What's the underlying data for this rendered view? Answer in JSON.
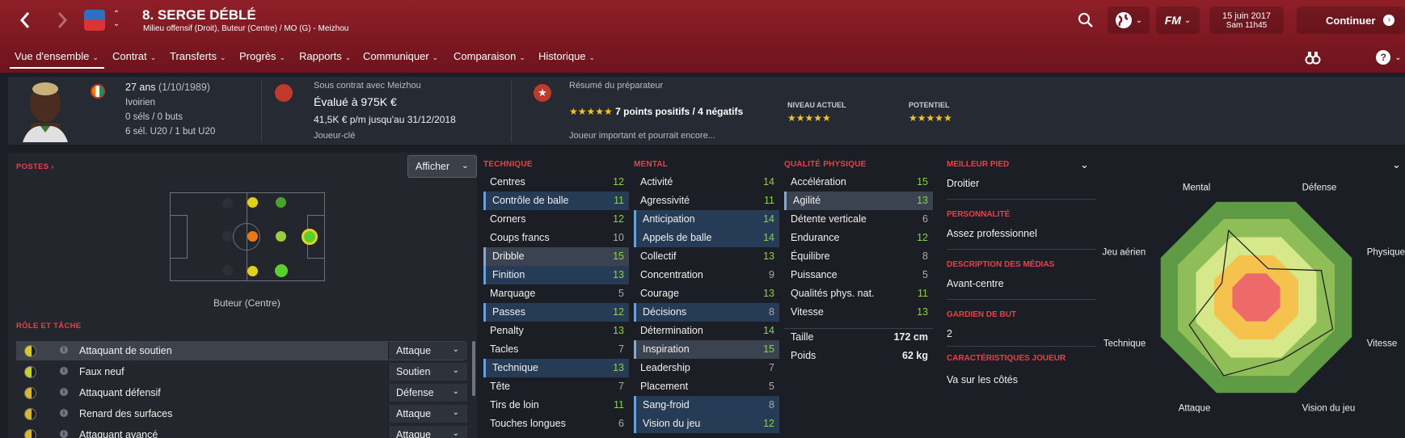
{
  "header": {
    "player_title": "8. SERGE DÉBLÉ",
    "player_subtitle": "Milieu offensif (Droit), Buteur (Centre) / MO (G) - Meizhou",
    "date": "15 juin 2017",
    "time": "Sam 11h45",
    "continue_label": "Continuer",
    "fm_label": "FM"
  },
  "nav": {
    "tabs": [
      "Vue d'ensemble",
      "Contrat",
      "Transferts",
      "Progrès",
      "Rapports",
      "Communiquer",
      "Comparaison",
      "Historique"
    ]
  },
  "summary": {
    "age": "27 ans",
    "dob": "(1/10/1989)",
    "nationality": "Ivoirien",
    "caps": "0 séls / 0 buts",
    "u20": "6 sél. U20 / 1 but U20",
    "contract_with": "Sous contrat avec Meizhou",
    "value": "Évalué à 975K €",
    "wage": "41,5K € p/m jusqu'au 31/12/2018",
    "status": "Joueur-clé",
    "coach_report_title": "Résumé du préparateur",
    "coach_stars": "★★★★★",
    "coach_points": "7 points positifs / 4 négatifs",
    "coach_summary": "Joueur important et pourrait encore...",
    "current_ability_label": "NIVEAU ACTUEL",
    "current_ability_stars": "★★★★★",
    "potential_label": "POTENTIEL",
    "potential_stars": "★★★★★"
  },
  "positions": {
    "title": "POSTES",
    "title_arrow": "›",
    "show_button": "Afficher",
    "position_label": "Buteur (Centre)"
  },
  "roles": {
    "title": "RÔLE ET TÂCHE",
    "items": [
      {
        "name": "Attaquant de soutien",
        "duty": "Attaque"
      },
      {
        "name": "Faux neuf",
        "duty": "Soutien"
      },
      {
        "name": "Attaquant défensif",
        "duty": "Défense"
      },
      {
        "name": "Renard des surfaces",
        "duty": "Attaque"
      },
      {
        "name": "Attaquant avancé",
        "duty": "Attaque"
      }
    ]
  },
  "technique": {
    "title": "TECHNIQUE",
    "items": [
      {
        "name": "Centres",
        "value": "12"
      },
      {
        "name": "Contrôle de balle",
        "value": "11"
      },
      {
        "name": "Corners",
        "value": "12"
      },
      {
        "name": "Coups francs",
        "value": "10"
      },
      {
        "name": "Dribble",
        "value": "15"
      },
      {
        "name": "Finition",
        "value": "13"
      },
      {
        "name": "Marquage",
        "value": "5"
      },
      {
        "name": "Passes",
        "value": "12"
      },
      {
        "name": "Penalty",
        "value": "13"
      },
      {
        "name": "Tacles",
        "value": "7"
      },
      {
        "name": "Technique",
        "value": "13"
      },
      {
        "name": "Tête",
        "value": "7"
      },
      {
        "name": "Tirs de loin",
        "value": "11"
      },
      {
        "name": "Touches longues",
        "value": "6"
      }
    ]
  },
  "mental": {
    "title": "MENTAL",
    "items": [
      {
        "name": "Activité",
        "value": "14"
      },
      {
        "name": "Agressivité",
        "value": "11"
      },
      {
        "name": "Anticipation",
        "value": "14"
      },
      {
        "name": "Appels de balle",
        "value": "14"
      },
      {
        "name": "Collectif",
        "value": "13"
      },
      {
        "name": "Concentration",
        "value": "9"
      },
      {
        "name": "Courage",
        "value": "13"
      },
      {
        "name": "Décisions",
        "value": "8"
      },
      {
        "name": "Détermination",
        "value": "14"
      },
      {
        "name": "Inspiration",
        "value": "15"
      },
      {
        "name": "Leadership",
        "value": "7"
      },
      {
        "name": "Placement",
        "value": "5"
      },
      {
        "name": "Sang-froid",
        "value": "8"
      },
      {
        "name": "Vision du jeu",
        "value": "12"
      }
    ]
  },
  "physical": {
    "title": "QUALITÉ PHYSIQUE",
    "items": [
      {
        "name": "Accélération",
        "value": "15"
      },
      {
        "name": "Agilité",
        "value": "13"
      },
      {
        "name": "Détente verticale",
        "value": "6"
      },
      {
        "name": "Endurance",
        "value": "12"
      },
      {
        "name": "Équilibre",
        "value": "8"
      },
      {
        "name": "Puissance",
        "value": "5"
      },
      {
        "name": "Qualités phys. nat.",
        "value": "11"
      },
      {
        "name": "Vitesse",
        "value": "13"
      }
    ],
    "height_label": "Taille",
    "height_value": "172 cm",
    "weight_label": "Poids",
    "weight_value": "62 kg"
  },
  "player_info": {
    "foot_label": "MEILLEUR PIED",
    "foot_value": "Droitier",
    "personality_label": "PERSONNALITÉ",
    "personality_value": "Assez professionnel",
    "media_label": "DESCRIPTION DES MÉDIAS",
    "media_value": "Avant-centre",
    "gk_label": "GARDIEN DE BUT",
    "gk_value": "2",
    "traits_label": "CARACTÉRISTIQUES JOUEUR",
    "traits_value": "Va sur les côtés"
  },
  "radar": {
    "labels": [
      "Défense",
      "Physique",
      "Vitesse",
      "Vision du jeu",
      "Attaque",
      "Technique",
      "Jeu aérien",
      "Mental"
    ],
    "values": [
      0.3,
      0.68,
      0.8,
      0.65,
      0.82,
      0.7,
      0.36,
      0.7
    ]
  },
  "colors": {
    "accent_red": "#e9404b",
    "value_green": "#8bd14a",
    "value_gray": "#aaaaaa",
    "star_yellow": "#f3c61f"
  }
}
